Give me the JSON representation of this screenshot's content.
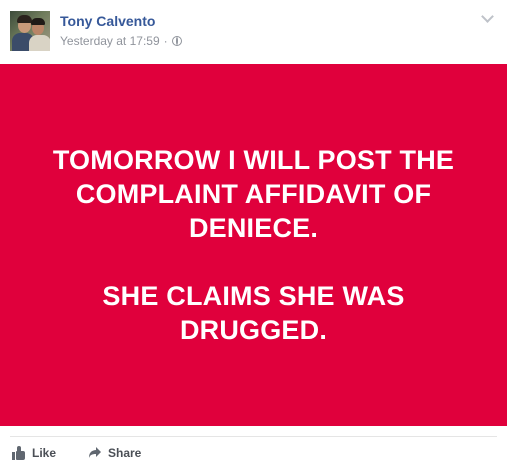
{
  "post": {
    "author": "Tony Calvento",
    "timestamp": "Yesterday at 17:59",
    "separator": "·",
    "privacy_icon": "globe-icon",
    "menu_icon": "chevron-down-icon"
  },
  "image": {
    "background_color": "#e0003c",
    "text_color": "#ffffff",
    "line1": "TOMORROW I WILL POST THE",
    "line2": "COMPLAINT AFFIDAVIT OF",
    "line3": "DENIECE.",
    "line4": "SHE CLAIMS SHE WAS",
    "line5": "DRUGGED."
  },
  "actions": {
    "like_label": "Like",
    "like_icon": "thumbs-up-icon",
    "share_label": "Share",
    "share_icon": "share-arrow-icon"
  },
  "colors": {
    "author_link": "#365899",
    "meta_text": "#90949c",
    "action_text": "#4b4f56"
  }
}
